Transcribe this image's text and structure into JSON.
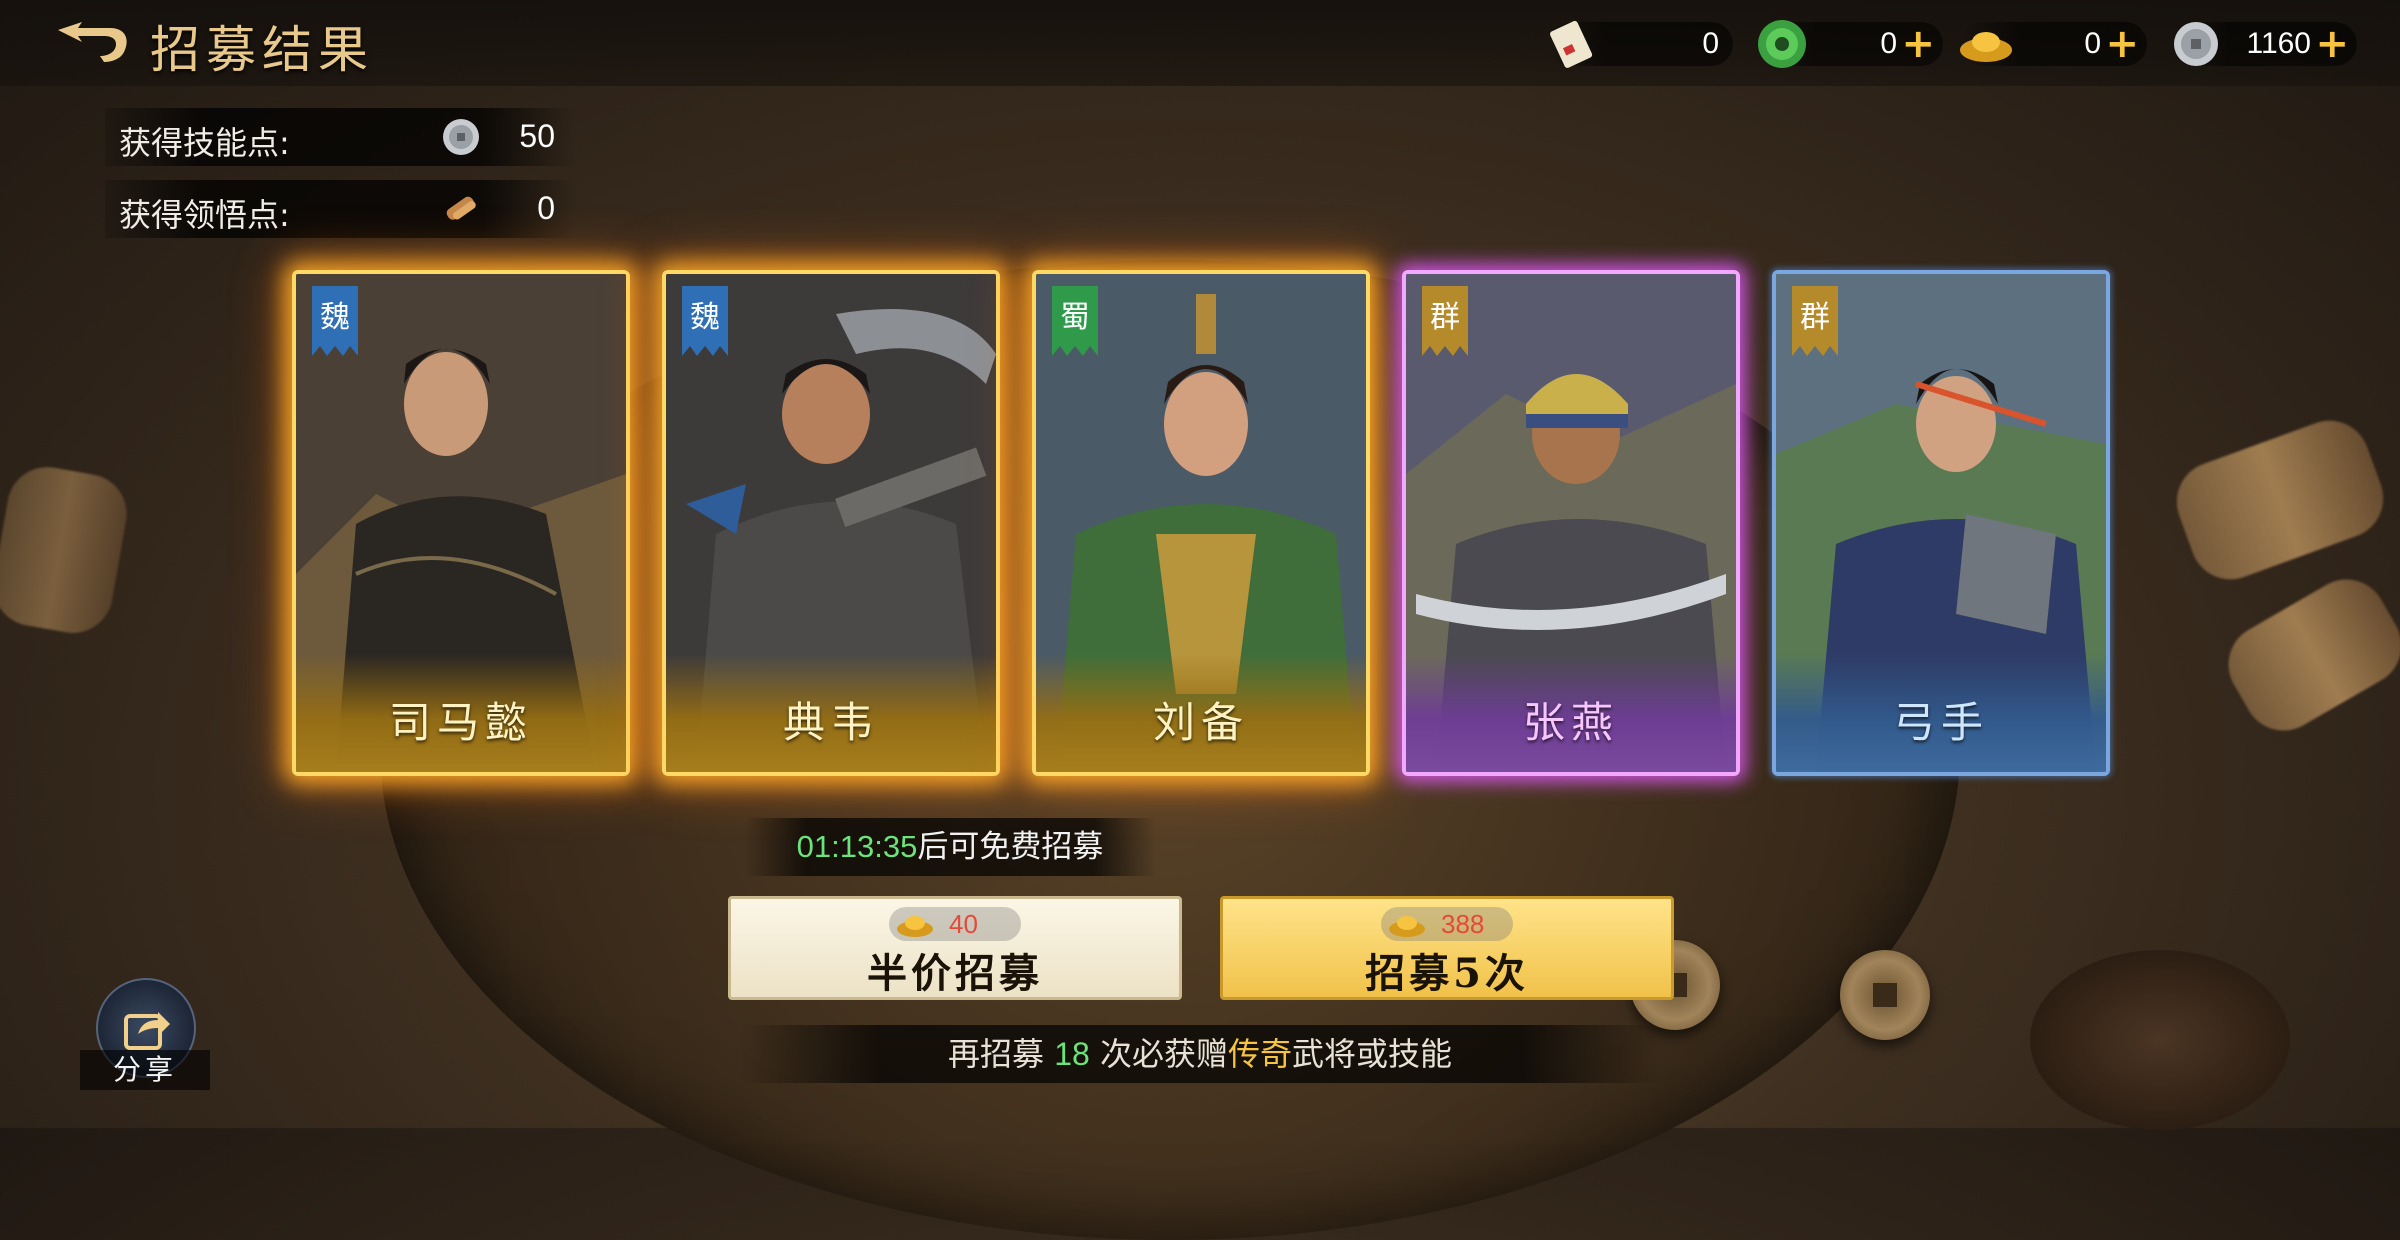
{
  "header": {
    "title": "招募结果",
    "back_icon": "back-arrow-icon"
  },
  "resources": [
    {
      "icon": "scroll-icon",
      "value": "0",
      "has_plus": false
    },
    {
      "icon": "jade-coin-icon",
      "value": "0",
      "has_plus": true
    },
    {
      "icon": "gold-ingot-icon",
      "value": "0",
      "has_plus": true
    },
    {
      "icon": "silver-coin-icon",
      "value": "1160",
      "has_plus": true
    }
  ],
  "gains": {
    "skill_points_label": "获得技能点:",
    "skill_points_value": "50",
    "insight_points_label": "获得领悟点:",
    "insight_points_value": "0"
  },
  "cards": [
    {
      "name": "司马懿",
      "faction": "魏",
      "rarity": "gold",
      "faction_color": "#2f6fb5"
    },
    {
      "name": "典韦",
      "faction": "魏",
      "rarity": "gold",
      "faction_color": "#2f6fb5"
    },
    {
      "name": "刘备",
      "faction": "蜀",
      "rarity": "gold",
      "faction_color": "#2e9a4a"
    },
    {
      "name": "张燕",
      "faction": "群",
      "rarity": "purple",
      "faction_color": "#b58a2a"
    },
    {
      "name": "弓手",
      "faction": "群",
      "rarity": "blue",
      "faction_color": "#b58a2a"
    }
  ],
  "timer": {
    "time": "01:13:35",
    "suffix": "后可免费招募"
  },
  "buttons": {
    "half_price": {
      "cost": "40",
      "label": "半价招募"
    },
    "five_times": {
      "cost": "388",
      "label": "招募5次"
    }
  },
  "pity": {
    "prefix": "再招募 ",
    "count": "18",
    "middle": " 次必获赠",
    "highlight": "传奇",
    "suffix": "武将或技能"
  },
  "share": {
    "label": "分享",
    "icon": "share-icon"
  },
  "colors": {
    "accent_gold": "#f6c440",
    "timer_green": "#6ce27a",
    "cost_red": "#e24a3a"
  }
}
